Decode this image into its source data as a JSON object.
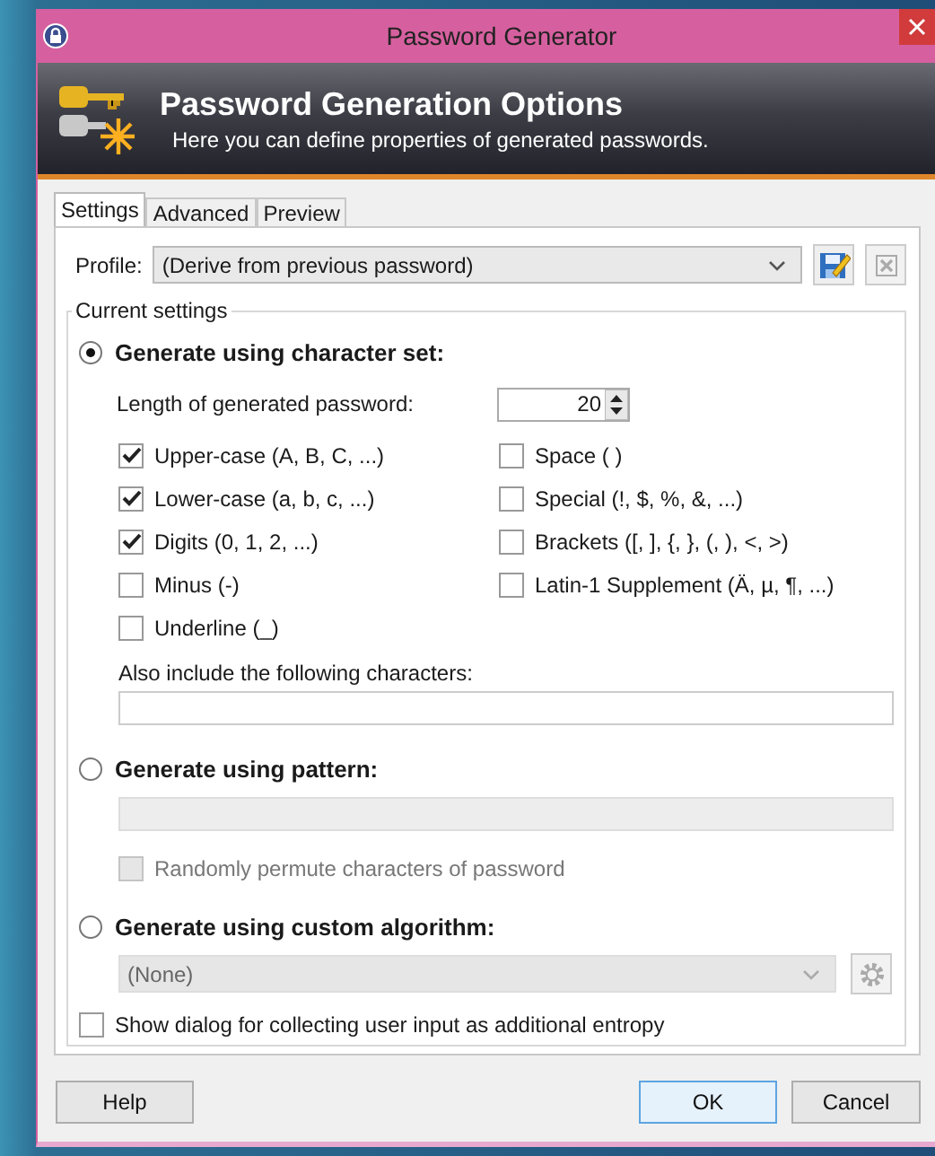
{
  "window": {
    "title": "Password Generator"
  },
  "header": {
    "title": "Password Generation Options",
    "subtitle": "Here you can define properties of generated passwords."
  },
  "tabs": [
    {
      "label": "Settings",
      "selected": true
    },
    {
      "label": "Advanced",
      "selected": false
    },
    {
      "label": "Preview",
      "selected": false
    }
  ],
  "profile": {
    "label": "Profile:",
    "value": "(Derive from previous password)",
    "delete_disabled": true
  },
  "group": {
    "title": "Current settings"
  },
  "charset": {
    "label": "Generate using character set:",
    "selected": true,
    "length_label": "Length of generated password:",
    "length_value": "20",
    "checkboxes": [
      {
        "label": "Upper-case (A, B, C, ...)",
        "checked": true
      },
      {
        "label": "Space ( )",
        "checked": false
      },
      {
        "label": "Lower-case (a, b, c, ...)",
        "checked": true
      },
      {
        "label": "Special (!, $, %, &, ...)",
        "checked": false
      },
      {
        "label": "Digits (0, 1, 2, ...)",
        "checked": true
      },
      {
        "label": "Brackets ([, ], {, }, (, ), <, >)",
        "checked": false
      },
      {
        "label": "Minus (-)",
        "checked": false
      },
      {
        "label": "Latin-1 Supplement (Ä, µ, ¶, ...)",
        "checked": false
      },
      {
        "label": "Underline (_)",
        "checked": false
      }
    ],
    "also_label": "Also include the following characters:"
  },
  "pattern": {
    "label": "Generate using pattern:",
    "selected": false,
    "disabled": true,
    "permute": {
      "label": "Randomly permute characters of password",
      "checked": false,
      "disabled": true
    }
  },
  "custom": {
    "label": "Generate using custom algorithm:",
    "selected": false,
    "disabled": true,
    "value": "(None)"
  },
  "entropy": {
    "label": "Show dialog for collecting user input as additional entropy",
    "checked": false
  },
  "buttons": [
    {
      "label": "Help",
      "default": false
    },
    {
      "label": "OK",
      "default": true
    },
    {
      "label": "Cancel",
      "default": false
    }
  ]
}
